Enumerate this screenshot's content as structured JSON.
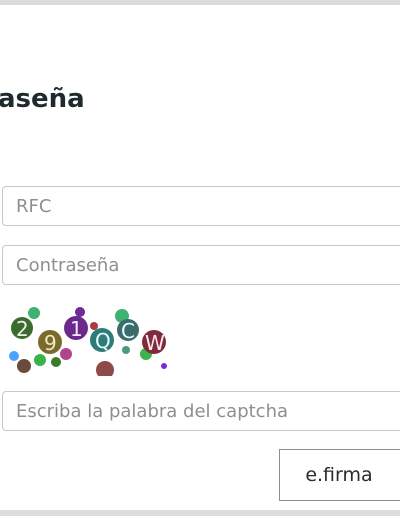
{
  "form": {
    "title_visible": "aseña",
    "rfc_placeholder": "RFC",
    "password_placeholder": "Contraseña",
    "captcha_placeholder": "Escriba la palabra del captcha",
    "efirma_label": "e.firma"
  },
  "captcha": {
    "characters": [
      "2",
      "9",
      "1",
      "Q",
      "C",
      "W"
    ]
  }
}
